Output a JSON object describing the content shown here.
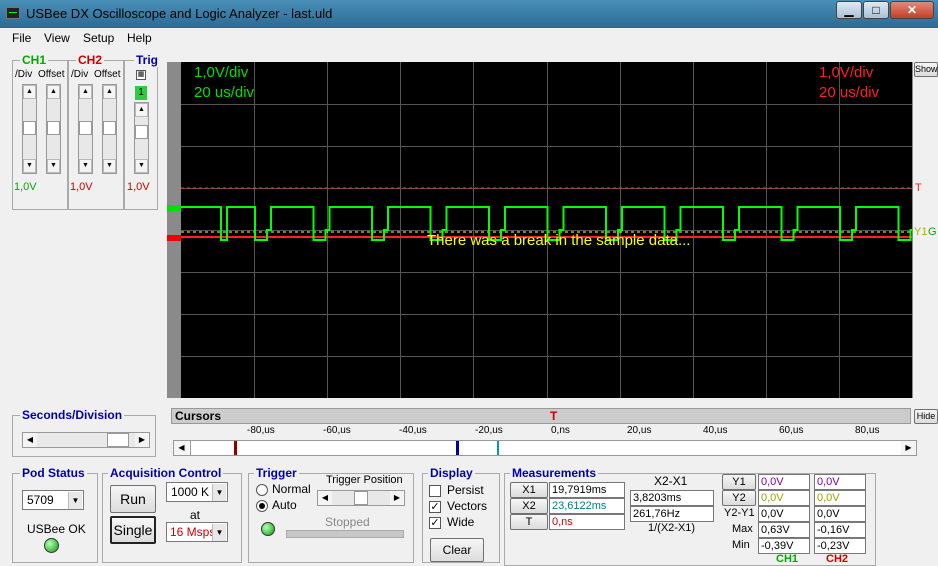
{
  "window": {
    "title": "USBee DX Oscilloscope and Logic Analyzer - last.uld",
    "minimize": "▁",
    "maximize": "□",
    "close": "✕"
  },
  "menu": [
    "File",
    "View",
    "Setup",
    "Help"
  ],
  "ch1": {
    "label": "CH1",
    "div_label": "/Div",
    "offset_label": "Offset",
    "value": "1,0V"
  },
  "ch2": {
    "label": "CH2",
    "div_label": "/Div",
    "offset_label": "Offset",
    "value": "1,0V"
  },
  "trig": {
    "label": "Trig",
    "level": "1",
    "value": "1,0V"
  },
  "scope": {
    "ch1_volts": "1,0V/div",
    "ch1_time": "20 us/div",
    "ch2_volts": "1,0V/div",
    "ch2_time": "20 us/div",
    "message": "There was a break in the sample data...",
    "trigger_marker": "T",
    "y1_marker": "Y1",
    "g_marker": "G",
    "show_button": "Show",
    "colors": {
      "ch1": "#00ff00",
      "ch2": "#ff2020",
      "message": "#ffff00"
    }
  },
  "seconds_division": {
    "label": "Seconds/Division"
  },
  "cursors": {
    "label": "Cursors",
    "trigger_marker": "T",
    "hide_button": "Hide",
    "ticks": [
      "-80,us",
      "-60,us",
      "-40,us",
      "-20,us",
      "0,ns",
      "20,us",
      "40,us",
      "60,us",
      "80,us"
    ]
  },
  "pod_status": {
    "label": "Pod Status",
    "pod_id": "5709",
    "status": "USBee OK"
  },
  "acquisition": {
    "label": "Acquisition Control",
    "run": "Run",
    "single": "Single",
    "samples": "1000 K",
    "at": "at",
    "rate": "16 Msps"
  },
  "trigger": {
    "label": "Trigger",
    "normal": "Normal",
    "auto": "Auto",
    "position_label": "Trigger Position",
    "state": "Stopped"
  },
  "display": {
    "label": "Display",
    "persist": "Persist",
    "vectors": "Vectors",
    "wide": "Wide",
    "clear": "Clear",
    "vectors_checked": "✓",
    "wide_checked": "✓"
  },
  "measurements": {
    "label": "Measurements",
    "x1_label": "X1",
    "x1_value": "19,7919ms",
    "x2_label": "X2",
    "x2_value": "23,6122ms",
    "t_label": "T",
    "t_value": "0,ns",
    "dx_label": "X2-X1",
    "dx_value": "3,8203ms",
    "freq_value": "261,76Hz",
    "freq_label": "1/(X2-X1)",
    "rows": [
      {
        "label": "Y1",
        "ch1": "0,0V",
        "ch2": "0,0V"
      },
      {
        "label": "Y2",
        "ch1": "0,0V",
        "ch2": "0,0V"
      },
      {
        "label": "Y2-Y1",
        "ch1": "0,0V",
        "ch2": "0,0V"
      },
      {
        "label": "Max",
        "ch1": "0,63V",
        "ch2": "-0,16V"
      },
      {
        "label": "Min",
        "ch1": "-0,39V",
        "ch2": "-0,23V"
      }
    ],
    "ch1_label": "CH1",
    "ch2_label": "CH2"
  }
}
